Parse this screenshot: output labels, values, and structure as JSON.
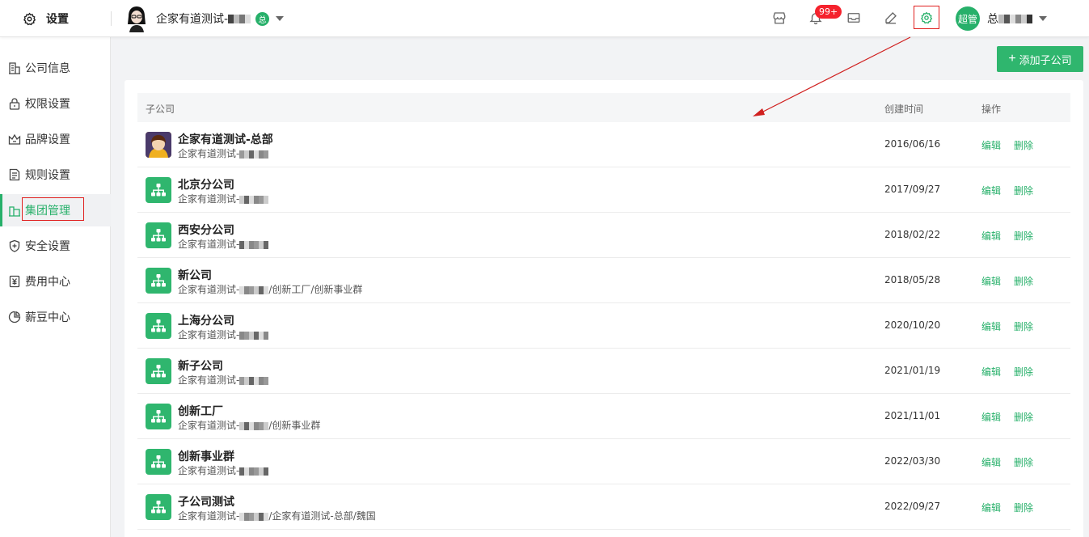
{
  "header": {
    "settings_title": "设置",
    "company_name": "企家有道测试-",
    "company_badge": "总",
    "notif_count": "99+",
    "user_badge": "超管",
    "user_name": "总"
  },
  "sidebar": {
    "items": [
      {
        "label": "公司信息",
        "icon": "building-icon"
      },
      {
        "label": "权限设置",
        "icon": "lock-icon"
      },
      {
        "label": "品牌设置",
        "icon": "crown-icon"
      },
      {
        "label": "规则设置",
        "icon": "document-icon"
      },
      {
        "label": "集团管理",
        "icon": "group-building-icon",
        "active": true
      },
      {
        "label": "安全设置",
        "icon": "shield-icon"
      },
      {
        "label": "费用中心",
        "icon": "yen-icon"
      },
      {
        "label": "薪豆中心",
        "icon": "bean-icon"
      }
    ]
  },
  "toolbar": {
    "add_label": "添加子公司"
  },
  "table": {
    "columns": [
      "子公司",
      "创建时间",
      "操作"
    ],
    "edit_label": "编辑",
    "delete_label": "删除",
    "rows": [
      {
        "name": "企家有道测试-总部",
        "path": "企家有道测试-",
        "date": "2016/06/16",
        "avatar": true
      },
      {
        "name": "北京分公司",
        "path": "企家有道测试-",
        "date": "2017/09/27"
      },
      {
        "name": "西安分公司",
        "path": "企家有道测试-",
        "date": "2018/02/22"
      },
      {
        "name": "新公司",
        "path": "企家有道测试-",
        "suffix": "/创新工厂/创新事业群",
        "date": "2018/05/28"
      },
      {
        "name": "上海分公司",
        "path": "企家有道测试-",
        "date": "2020/10/20"
      },
      {
        "name": "新子公司",
        "path": "企家有道测试-",
        "date": "2021/01/19"
      },
      {
        "name": "创新工厂",
        "path": "企家有道测试-",
        "suffix": "/创新事业群",
        "date": "2021/11/01"
      },
      {
        "name": "创新事业群",
        "path": "企家有道测试-",
        "date": "2022/03/30"
      },
      {
        "name": "子公司测试",
        "path": "企家有道测试-",
        "suffix": "/企家有道测试-总部/魏国",
        "date": "2022/09/27"
      }
    ]
  },
  "colors": {
    "accent": "#27b06a",
    "highlight": "#e0201f"
  }
}
